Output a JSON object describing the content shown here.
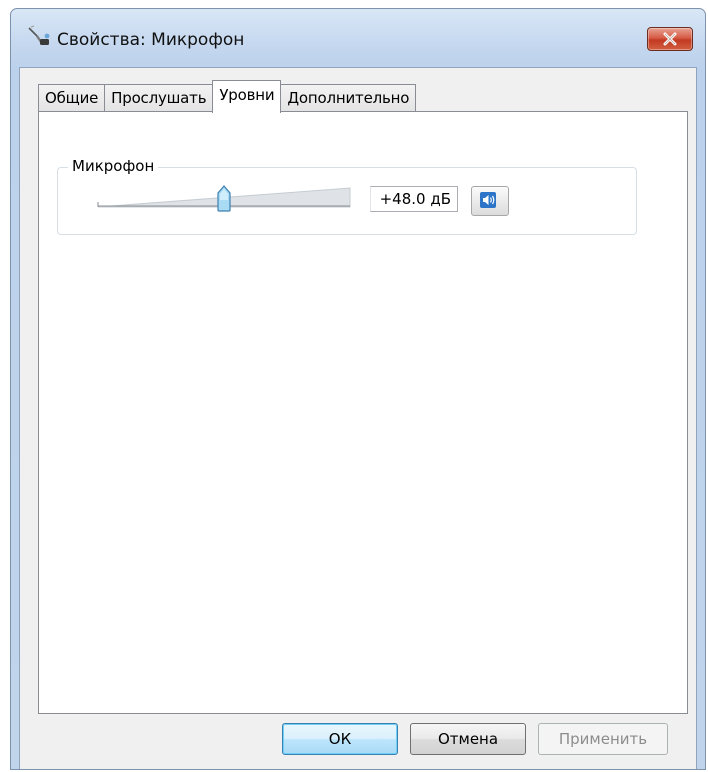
{
  "window": {
    "title": "Свойства: Микрофон",
    "close_icon": "close-x-icon"
  },
  "tabs": [
    {
      "label": "Общие",
      "active": false
    },
    {
      "label": "Прослушать",
      "active": false
    },
    {
      "label": "Уровни",
      "active": true
    },
    {
      "label": "Дополнительно",
      "active": false
    }
  ],
  "levels": {
    "group_label": "Микрофон",
    "slider_value_fraction": 0.5,
    "level_text": "+48.0 дБ",
    "mute_icon": "speaker-icon"
  },
  "buttons": {
    "ok": "ОК",
    "cancel": "Отмена",
    "apply": "Применить"
  },
  "colors": {
    "close_button": "#c23a22",
    "title_bar": "#c3d6ee",
    "ok_border": "#3c7fb1"
  }
}
